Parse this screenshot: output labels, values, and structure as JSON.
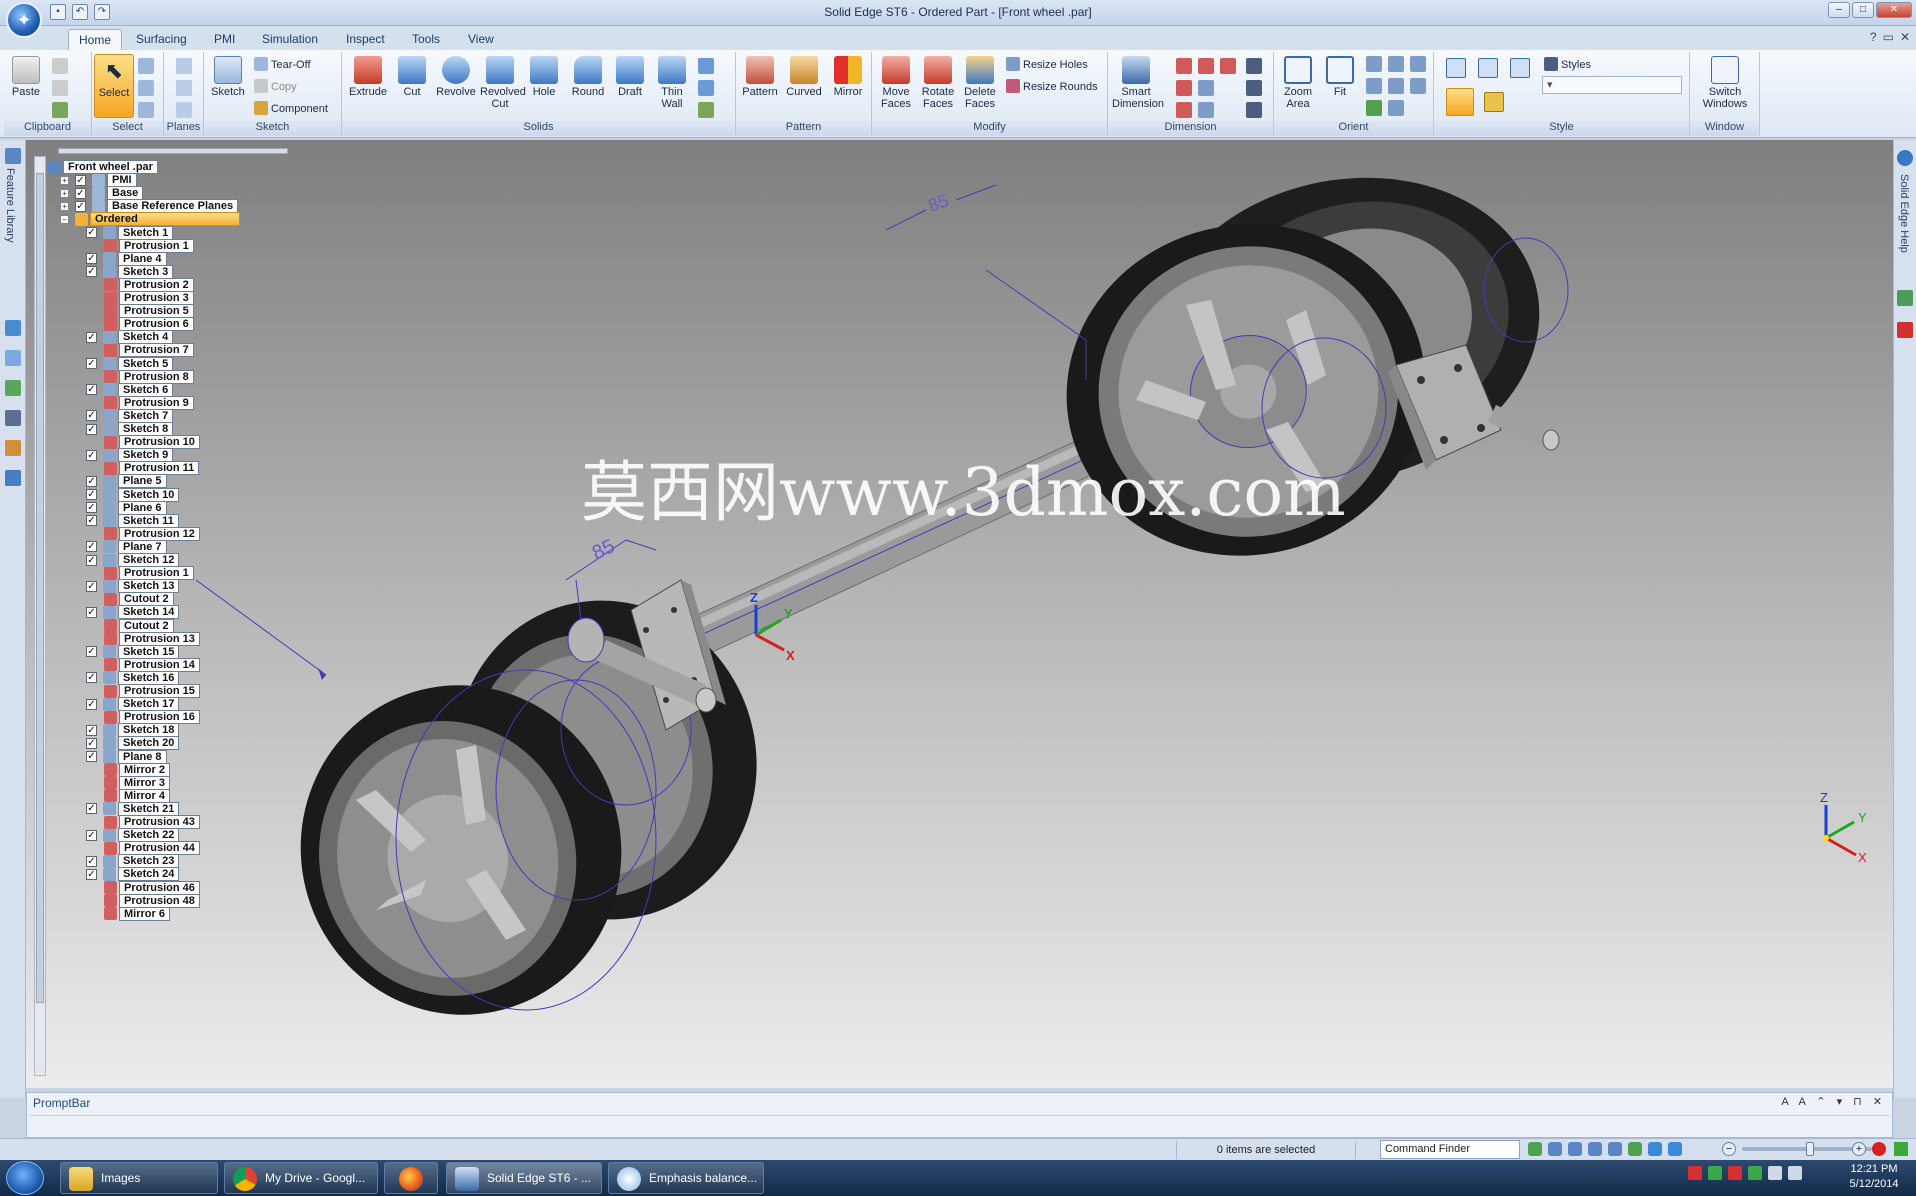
{
  "window": {
    "title": "Solid Edge ST6 - Ordered Part - [Front wheel .par]"
  },
  "tabs": [
    "Home",
    "Surfacing",
    "PMI",
    "Simulation",
    "Inspect",
    "Tools",
    "View"
  ],
  "ribbon": {
    "clipboard": {
      "label": "Clipboard",
      "paste": "Paste"
    },
    "select": {
      "label": "Select",
      "select": "Select"
    },
    "planes": {
      "label": "Planes"
    },
    "sketch": {
      "label": "Sketch",
      "sketch": "Sketch",
      "tear_off": "Tear-Off",
      "copy": "Copy",
      "component": "Component"
    },
    "solids": {
      "label": "Solids",
      "extrude": "Extrude",
      "cut": "Cut",
      "revolve": "Revolve",
      "revolved": "Revolved",
      "revolved_cut": "Cut",
      "hole": "Hole",
      "round": "Round",
      "draft": "Draft",
      "thin": "Thin",
      "wall": "Wall"
    },
    "pattern": {
      "label": "Pattern",
      "pattern": "Pattern",
      "curved": "Curved",
      "mirror": "Mirror"
    },
    "modify": {
      "label": "Modify",
      "move": "Move",
      "move_faces": "Faces",
      "rotate": "Rotate",
      "rotate_faces": "Faces",
      "delete": "Delete",
      "delete_faces": "Faces",
      "resize_holes": "Resize Holes",
      "resize_rounds": "Resize Rounds"
    },
    "dimension": {
      "label": "Dimension",
      "smart": "Smart",
      "smart_dimension": "Dimension"
    },
    "orient": {
      "label": "Orient",
      "zoom": "Zoom",
      "zoom_area": "Area",
      "fit": "Fit"
    },
    "style": {
      "label": "Style",
      "styles": "Styles"
    },
    "window": {
      "label": "Window",
      "switch": "Switch",
      "switch_windows": "Windows"
    }
  },
  "side": {
    "left_label": "Feature Library",
    "right_label": "Solid Edge Help"
  },
  "tree": {
    "nodes": [
      {
        "label": "Front wheel .par",
        "icon": "part-icon"
      },
      {
        "label": "PMI",
        "icon": "pmi-icon"
      },
      {
        "label": "Base",
        "icon": "base-icon"
      },
      {
        "label": "Base Reference Planes",
        "icon": "plane-icon"
      },
      {
        "label": "Ordered",
        "icon": "ordered-icon"
      },
      {
        "label": "Sketch 1"
      },
      {
        "label": "Protrusion 1"
      },
      {
        "label": "Plane 4"
      },
      {
        "label": "Sketch 3"
      },
      {
        "label": "Protrusion 2"
      },
      {
        "label": "Protrusion 3"
      },
      {
        "label": "Protrusion 5"
      },
      {
        "label": "Protrusion 6"
      },
      {
        "label": "Sketch 4"
      },
      {
        "label": "Protrusion 7"
      },
      {
        "label": "Sketch 5"
      },
      {
        "label": "Protrusion 8"
      },
      {
        "label": "Sketch 6"
      },
      {
        "label": "Protrusion 9"
      },
      {
        "label": "Sketch 7"
      },
      {
        "label": "Sketch 8"
      },
      {
        "label": "Protrusion 10"
      },
      {
        "label": "Sketch 9"
      },
      {
        "label": "Protrusion 11"
      },
      {
        "label": "Plane 5"
      },
      {
        "label": "Sketch 10"
      },
      {
        "label": "Plane 6"
      },
      {
        "label": "Sketch 11"
      },
      {
        "label": "Protrusion 12"
      },
      {
        "label": "Plane 7"
      },
      {
        "label": "Sketch 12"
      },
      {
        "label": "Protrusion 1"
      },
      {
        "label": "Sketch 13"
      },
      {
        "label": "Cutout 2"
      },
      {
        "label": "Sketch 14"
      },
      {
        "label": "Cutout 2"
      },
      {
        "label": "Protrusion 13"
      },
      {
        "label": "Sketch 15"
      },
      {
        "label": "Protrusion 14"
      },
      {
        "label": "Sketch 16"
      },
      {
        "label": "Protrusion 15"
      },
      {
        "label": "Sketch 17"
      },
      {
        "label": "Protrusion 16"
      },
      {
        "label": "Sketch 18"
      },
      {
        "label": "Sketch 20"
      },
      {
        "label": "Plane 8"
      },
      {
        "label": "Mirror 2"
      },
      {
        "label": "Mirror 3"
      },
      {
        "label": "Mirror 4"
      },
      {
        "label": "Sketch 21"
      },
      {
        "label": "Protrusion 43"
      },
      {
        "label": "Sketch 22"
      },
      {
        "label": "Protrusion 44"
      },
      {
        "label": "Sketch 23"
      },
      {
        "label": "Sketch 24"
      },
      {
        "label": "Protrusion 46"
      },
      {
        "label": "Protrusion 48"
      },
      {
        "label": "Mirror 6"
      }
    ]
  },
  "viewport": {
    "watermark": "莫西网www.3dmox.com",
    "dimension_near": "85",
    "dimension_far": "85",
    "triad": {
      "x": "X",
      "y": "Y",
      "z": "Z"
    }
  },
  "promptbar": {
    "title": "PromptBar"
  },
  "status": {
    "selection": "0 items are selected",
    "command_finder": "Command Finder"
  },
  "taskbar": {
    "items": [
      "Images",
      "My Drive - Googl...",
      "",
      "Solid Edge ST6 - ...",
      "Emphasis balance..."
    ],
    "time": "12:21 PM",
    "date": "5/12/2014"
  },
  "colors": {
    "accent": "#1f5fb3",
    "selected_node": "#f5b133",
    "viewport_top": "#7f7f7f",
    "viewport_bottom": "#ececec",
    "wheel_tire": "#1e1e1e",
    "wheel_rim": "#8a8a8a",
    "sketch_line": "#4b36b8"
  }
}
